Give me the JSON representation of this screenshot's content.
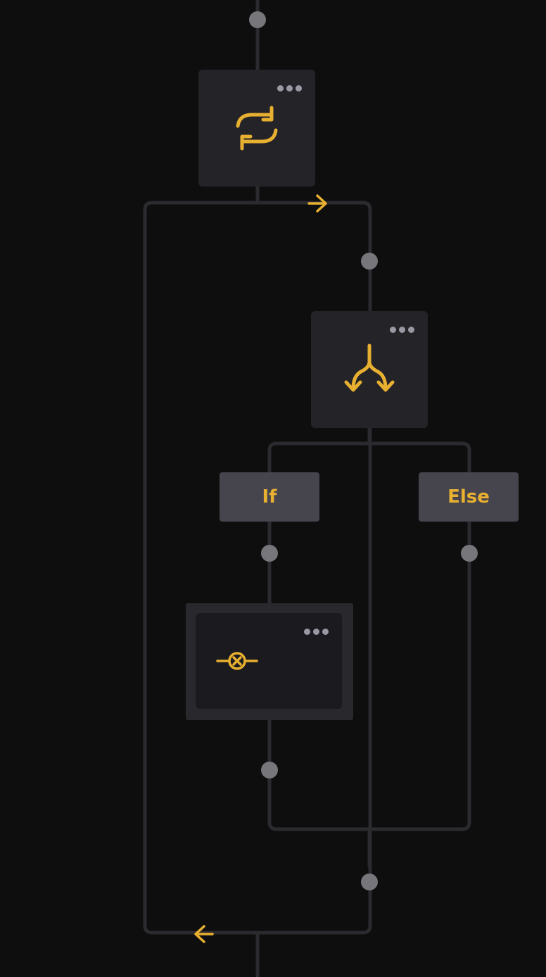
{
  "theme": {
    "background": "#0e0e0f",
    "connector": "#2b2a2f",
    "port": "#77767b",
    "node": "#242328",
    "accent": "#e8b030",
    "label_bg": "#46444d",
    "menu_dot": "#9a98a3"
  },
  "nodes": {
    "loop": {
      "icon": "loop-icon",
      "menu_icon": "more-options-icon"
    },
    "branch": {
      "icon": "branch-split-icon",
      "menu_icon": "more-options-icon"
    },
    "action": {
      "icon": "breakpoint-icon",
      "menu_icon": "more-options-icon"
    }
  },
  "branches": {
    "if_label": "If",
    "else_label": "Else"
  },
  "loop_arrows": {
    "forward": "arrow-right-icon",
    "back": "arrow-left-icon"
  }
}
